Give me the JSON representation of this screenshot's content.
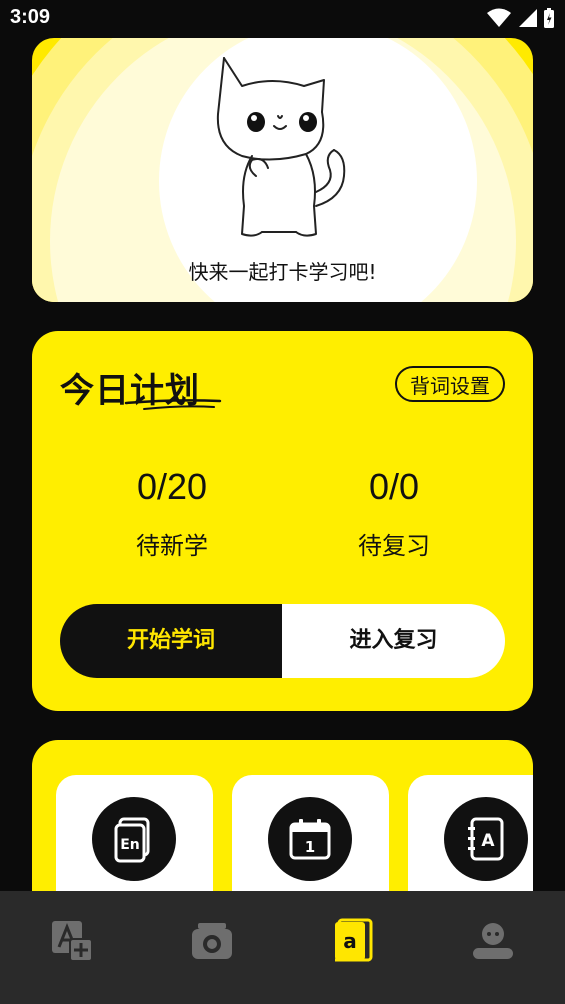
{
  "status_bar": {
    "time": "3:09"
  },
  "banner": {
    "slogan": "快来一起打卡学习吧!"
  },
  "plan": {
    "title": "今日计划",
    "settings_label": "背词设置",
    "new_words_value": "0/20",
    "new_words_label": "待新学",
    "review_value": "0/0",
    "review_label": "待复习",
    "start_label": "开始学词",
    "review_button_label": "进入复习"
  },
  "tools": [
    {
      "icon": "en-card-icon",
      "icon_text": "En"
    },
    {
      "icon": "calendar-icon",
      "icon_text": "1"
    },
    {
      "icon": "address-book-icon",
      "icon_text": "A"
    }
  ],
  "tab_bar": {
    "items": [
      {
        "icon": "translate-icon",
        "active": false
      },
      {
        "icon": "camera-icon",
        "active": false
      },
      {
        "icon": "wordbook-icon",
        "active": true
      },
      {
        "icon": "profile-icon",
        "active": false
      }
    ]
  },
  "colors": {
    "accent": "#ffee00",
    "dark": "#111111",
    "tab_bar": "#2a2a2a",
    "inactive_icon": "#6e6e6e"
  }
}
